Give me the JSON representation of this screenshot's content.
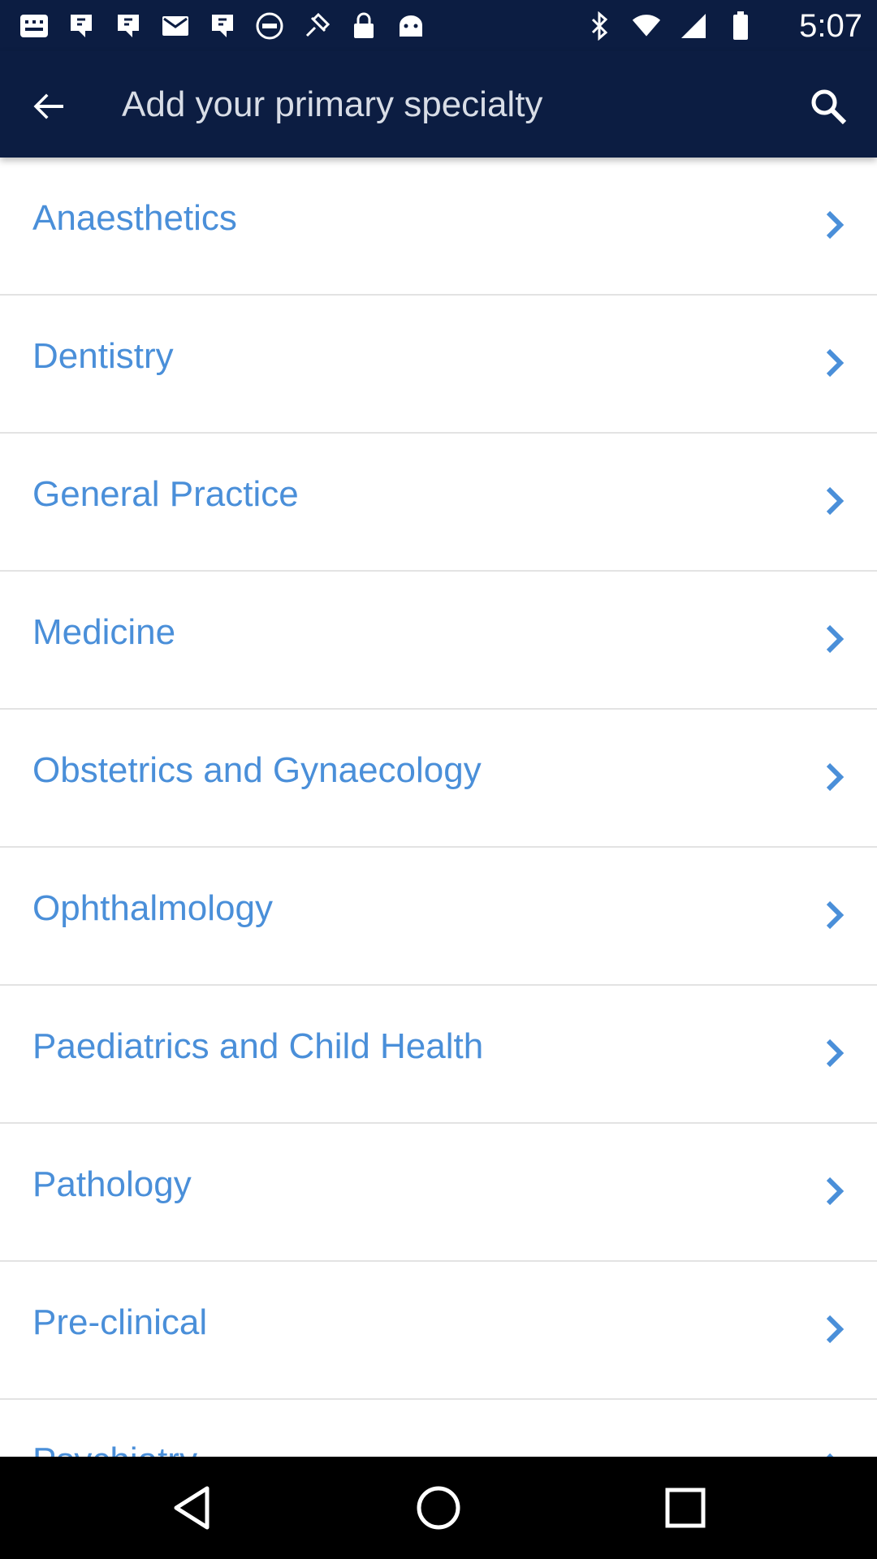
{
  "status_bar": {
    "time": "5:07",
    "left_icons": [
      "messages-icon",
      "hashtag-icon",
      "hashtag-icon",
      "mail-icon",
      "hashtag-icon",
      "no-disturb-icon",
      "fake-gps-icon",
      "lock-icon",
      "android-icon"
    ],
    "right_icons": [
      "bluetooth-icon",
      "wifi-icon",
      "signal-icon",
      "battery-icon"
    ]
  },
  "app_bar": {
    "search_placeholder": "Add your primary specialty",
    "back_icon": "arrow-back-icon",
    "search_icon": "search-icon"
  },
  "specialties": [
    {
      "label": "Anaesthetics"
    },
    {
      "label": "Dentistry"
    },
    {
      "label": "General Practice"
    },
    {
      "label": "Medicine"
    },
    {
      "label": "Obstetrics and Gynaecology"
    },
    {
      "label": "Ophthalmology"
    },
    {
      "label": "Paediatrics and Child Health"
    },
    {
      "label": "Pathology"
    },
    {
      "label": "Pre-clinical"
    },
    {
      "label": "Psychiatry"
    }
  ],
  "colors": {
    "app_bar": "#0c1d42",
    "accent": "#4a8fd9",
    "divider": "#e3e3e3"
  },
  "nav_bar": {
    "buttons": [
      "back-triangle-icon",
      "home-circle-icon",
      "recents-square-icon"
    ]
  }
}
